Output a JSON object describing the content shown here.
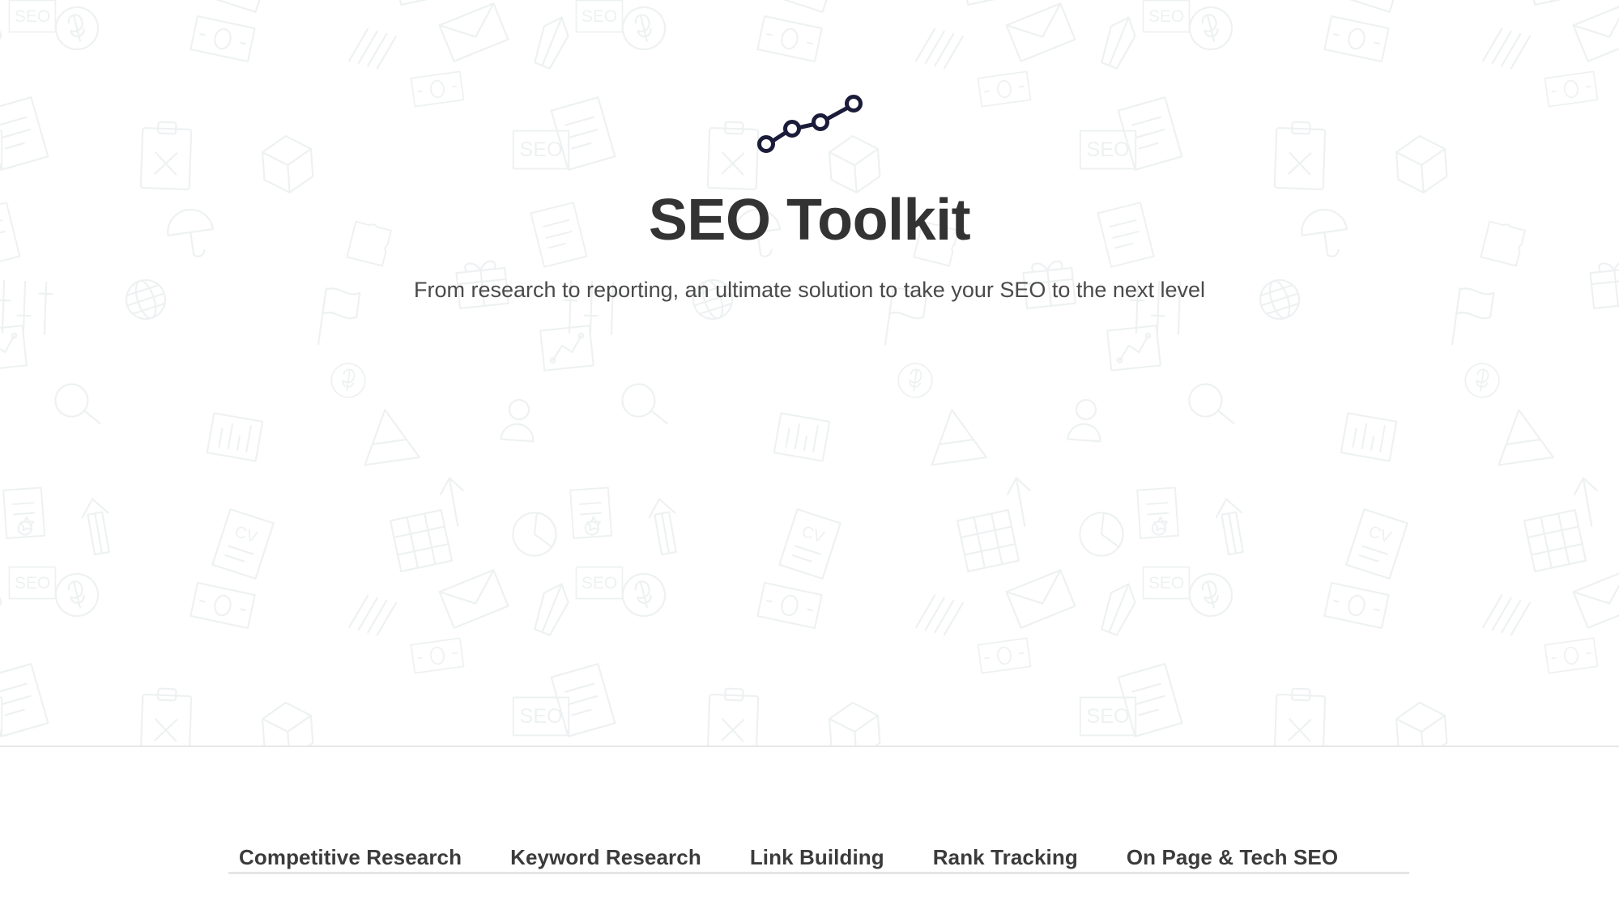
{
  "hero": {
    "logo_icon": "line-chart-trend-icon",
    "logo_color": "#1b1b3a",
    "title": "SEO Toolkit",
    "title_color": "#333333",
    "subtitle": "From research to reporting, an ultimate solution to take your SEO to the next level",
    "subtitle_color": "#4a4a4a",
    "background": {
      "base_color": "#ffffff",
      "pattern_color": "#eef1f2",
      "pattern_name": "seo-icons-line-art-pattern",
      "pattern_motifs": [
        "SEO",
        "CV",
        "dollar-coin",
        "clipboard",
        "box",
        "envelope",
        "flag",
        "globe-document",
        "magnifier",
        "bar-chart",
        "arrow-up",
        "gift",
        "banknote",
        "sliders",
        "award-ribbon",
        "pen",
        "umbrella",
        "grid",
        "puzzle"
      ]
    },
    "divider_color": "#e6e8ea"
  },
  "tabs": {
    "items": [
      {
        "label": "Competitive Research"
      },
      {
        "label": "Keyword Research"
      },
      {
        "label": "Link Building"
      },
      {
        "label": "Rank Tracking"
      },
      {
        "label": "On Page & Tech SEO"
      }
    ],
    "text_color": "#3b3b3b",
    "underline_color": "#e3e5e7"
  }
}
